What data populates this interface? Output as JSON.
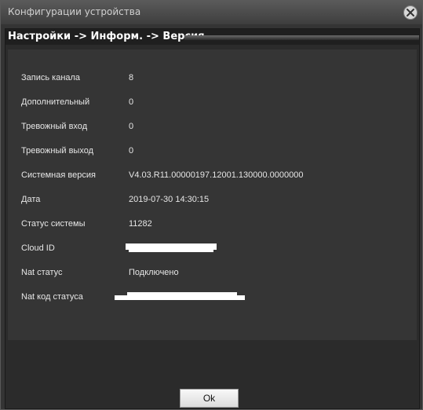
{
  "window": {
    "title": "Конфигурации устройства"
  },
  "breadcrumb": "Настройки -> Информ. -> Версия",
  "info": [
    {
      "label": "Запись канала",
      "value": "8"
    },
    {
      "label": "Дополнительный",
      "value": "0"
    },
    {
      "label": "Тревожный вход",
      "value": "0"
    },
    {
      "label": "Тревожный выход",
      "value": "0"
    },
    {
      "label": "Системная версия",
      "value": "V4.03.R11.00000197.12001.130000.0000000"
    },
    {
      "label": "Дата",
      "value": "2019-07-30 14:30:15"
    },
    {
      "label": "Статус системы",
      "value": "11282"
    },
    {
      "label": "Cloud ID",
      "value": ""
    },
    {
      "label": "Nat статус",
      "value": "Подключено"
    },
    {
      "label": "Nat код статуса",
      "value": ""
    }
  ],
  "buttons": {
    "ok": "Ok"
  }
}
